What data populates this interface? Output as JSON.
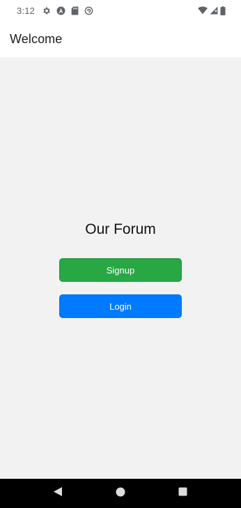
{
  "status_bar": {
    "time": "3:12",
    "left_icons": [
      "settings-icon",
      "android-icon",
      "sd-card-icon",
      "sync-icon"
    ],
    "right_icons": [
      "wifi-icon",
      "cell-signal-icon",
      "battery-icon"
    ]
  },
  "app_bar": {
    "title": "Welcome"
  },
  "main": {
    "title": "Our Forum",
    "signup_label": "Signup",
    "login_label": "Login"
  },
  "colors": {
    "signup": "#28a745",
    "login": "#007bff",
    "background": "#f2f2f2",
    "nav_bar": "#000000"
  },
  "nav_bar": {
    "icons": [
      "back-icon",
      "home-icon",
      "recents-icon"
    ]
  }
}
